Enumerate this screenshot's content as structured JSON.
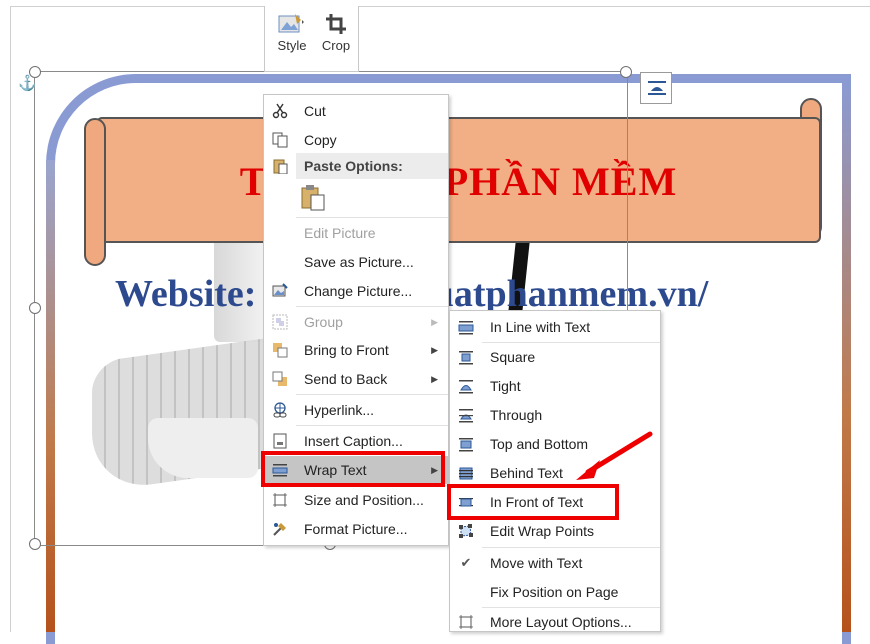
{
  "mini_toolbar": {
    "style_label": "Style",
    "crop_label": "Crop"
  },
  "picture": {
    "banner_text": "THU       T PHẦN MỀM",
    "website_text": "Website:               thuatphanmem.vn/"
  },
  "context_menu": {
    "cut": "Cut",
    "copy": "Copy",
    "paste_options_header": "Paste Options:",
    "edit_picture": "Edit Picture",
    "save_as_picture": "Save as Picture...",
    "change_picture": "Change Picture...",
    "group": "Group",
    "bring_to_front": "Bring to Front",
    "send_to_back": "Send to Back",
    "hyperlink": "Hyperlink...",
    "insert_caption": "Insert Caption...",
    "wrap_text": "Wrap Text",
    "size_and_position": "Size and Position...",
    "format_picture": "Format Picture..."
  },
  "wrap_submenu": {
    "in_line_with_text": "In Line with Text",
    "square": "Square",
    "tight": "Tight",
    "through": "Through",
    "top_and_bottom": "Top and Bottom",
    "behind_text": "Behind Text",
    "in_front_of_text": "In Front of Text",
    "edit_wrap_points": "Edit Wrap Points",
    "move_with_text": "Move with Text",
    "fix_position_on_page": "Fix Position on Page",
    "more_layout_options": "More Layout Options..."
  },
  "colors": {
    "highlight_box": "#ee0000",
    "banner_text": "#e00000",
    "website_text": "#2d4a8e",
    "menu_hover": "#c5c5c5"
  }
}
